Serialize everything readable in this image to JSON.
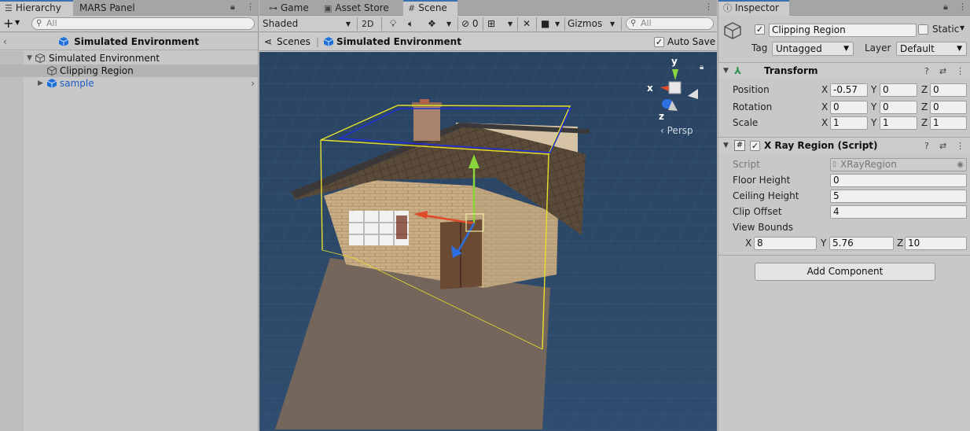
{
  "hierarchy": {
    "tabs": [
      "Hierarchy",
      "MARS Panel"
    ],
    "search_placeholder": "All",
    "header_title": "Simulated Environment",
    "items": [
      {
        "label": "Simulated Environment"
      },
      {
        "label": "Clipping Region"
      },
      {
        "label": "sample"
      }
    ]
  },
  "scene": {
    "tabs": [
      "Game",
      "Asset Store",
      "Scene"
    ],
    "shading_mode": "Shaded",
    "mode_2d": "2D",
    "hidden_count": "0",
    "gizmos_label": "Gizmos",
    "search_placeholder": "All",
    "breadcrumb": {
      "scenes": "Scenes",
      "current": "Simulated Environment"
    },
    "auto_save_label": "Auto Save",
    "gizmo": {
      "x": "x",
      "y": "y",
      "z": "z",
      "projection": "Persp"
    }
  },
  "inspector": {
    "tab": "Inspector",
    "object_name": "Clipping Region",
    "static_label": "Static",
    "tag_label": "Tag",
    "tag_value": "Untagged",
    "layer_label": "Layer",
    "layer_value": "Default",
    "transform": {
      "title": "Transform",
      "position_label": "Position",
      "rotation_label": "Rotation",
      "scale_label": "Scale",
      "position": {
        "x": "-0.57",
        "y": "0",
        "z": "0"
      },
      "rotation": {
        "x": "0",
        "y": "0",
        "z": "0"
      },
      "scale": {
        "x": "1",
        "y": "1",
        "z": "1"
      }
    },
    "xray": {
      "title": "X Ray Region (Script)",
      "script_label": "Script",
      "script_value": "XRayRegion",
      "floor_height_label": "Floor Height",
      "floor_height": "0",
      "ceiling_height_label": "Ceiling Height",
      "ceiling_height": "5",
      "clip_offset_label": "Clip Offset",
      "clip_offset": "4",
      "view_bounds_label": "View Bounds",
      "view_bounds": {
        "x": "8",
        "y": "5.76",
        "z": "10"
      }
    },
    "add_component": "Add Component",
    "axis_labels": {
      "x": "X",
      "y": "Y",
      "z": "Z"
    }
  },
  "colors": {
    "accent": "#3a72b0",
    "scene_bg": "#2f4a66",
    "link_blue": "#1e5bc6"
  }
}
